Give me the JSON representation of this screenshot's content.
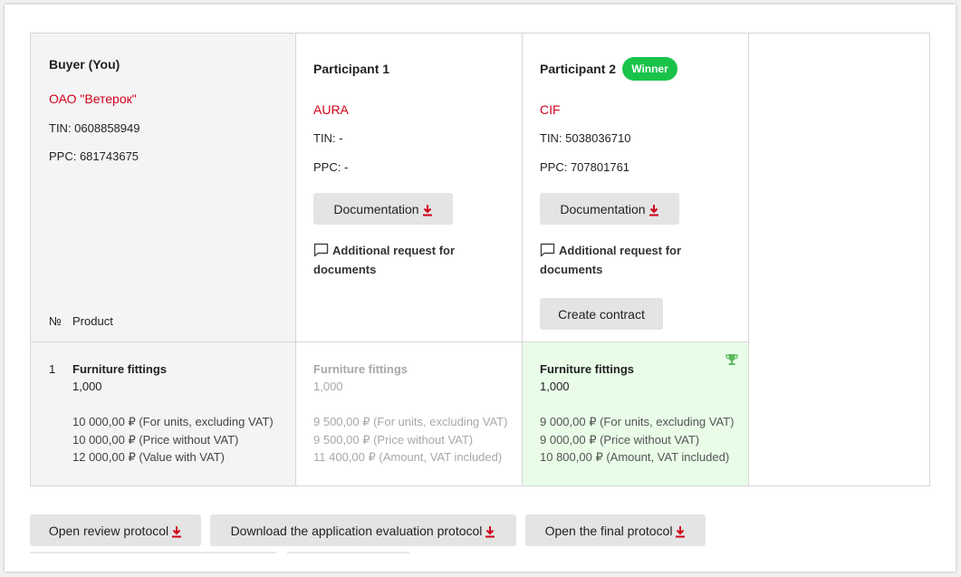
{
  "buyer": {
    "header": "Buyer (You)",
    "company": "ОАО \"Ветерок\"",
    "tin": "TIN: 0608858949",
    "ppc": "PPC: 681743675",
    "num_header": "№",
    "product_header": "Product",
    "row": {
      "num": "1",
      "name": "Furniture fittings",
      "qty": "1,000",
      "price_units": "10 000,00 ₽ (For units, excluding VAT)",
      "price_no_vat": "10 000,00 ₽ (Price without VAT)",
      "price_vat": "12 000,00 ₽ (Value with VAT)"
    }
  },
  "participants": [
    {
      "header": "Participant 1",
      "company": "AURA",
      "tin": "TIN: -",
      "ppc": "PPC: -",
      "documentation_label": "Documentation",
      "additional_request": "Additional request for documents",
      "row": {
        "name": "Furniture fittings",
        "qty": "1,000",
        "price_units": "9 500,00 ₽ (For units, excluding VAT)",
        "price_no_vat": "9 500,00 ₽ (Price without VAT)",
        "price_vat": "11 400,00 ₽ (Amount, VAT included)"
      }
    },
    {
      "header": "Participant 2",
      "badge": "Winner",
      "company": "CIF",
      "tin": "TIN: 5038036710",
      "ppc": "PPC: 707801761",
      "documentation_label": "Documentation",
      "additional_request": "Additional request for documents",
      "create_contract_label": "Create contract",
      "row": {
        "name": "Furniture fittings",
        "qty": "1,000",
        "price_units": "9 000,00 ₽ (For units, excluding VAT)",
        "price_no_vat": "9 000,00 ₽ (Price without VAT)",
        "price_vat": "10 800,00 ₽ (Amount, VAT included)"
      }
    }
  ],
  "footer": {
    "open_review": "Open review protocol",
    "download_evaluation": "Download the application evaluation protocol",
    "open_final": "Open the final protocol"
  },
  "colors": {
    "accent_red": "#d0021b",
    "winner_green": "#19c34a",
    "winner_cell_bg": "#e8fce8",
    "trophy": "#5cb85c"
  },
  "icons": {
    "download": "download-arrow-icon",
    "comment": "comment-icon",
    "trophy": "trophy-icon"
  }
}
